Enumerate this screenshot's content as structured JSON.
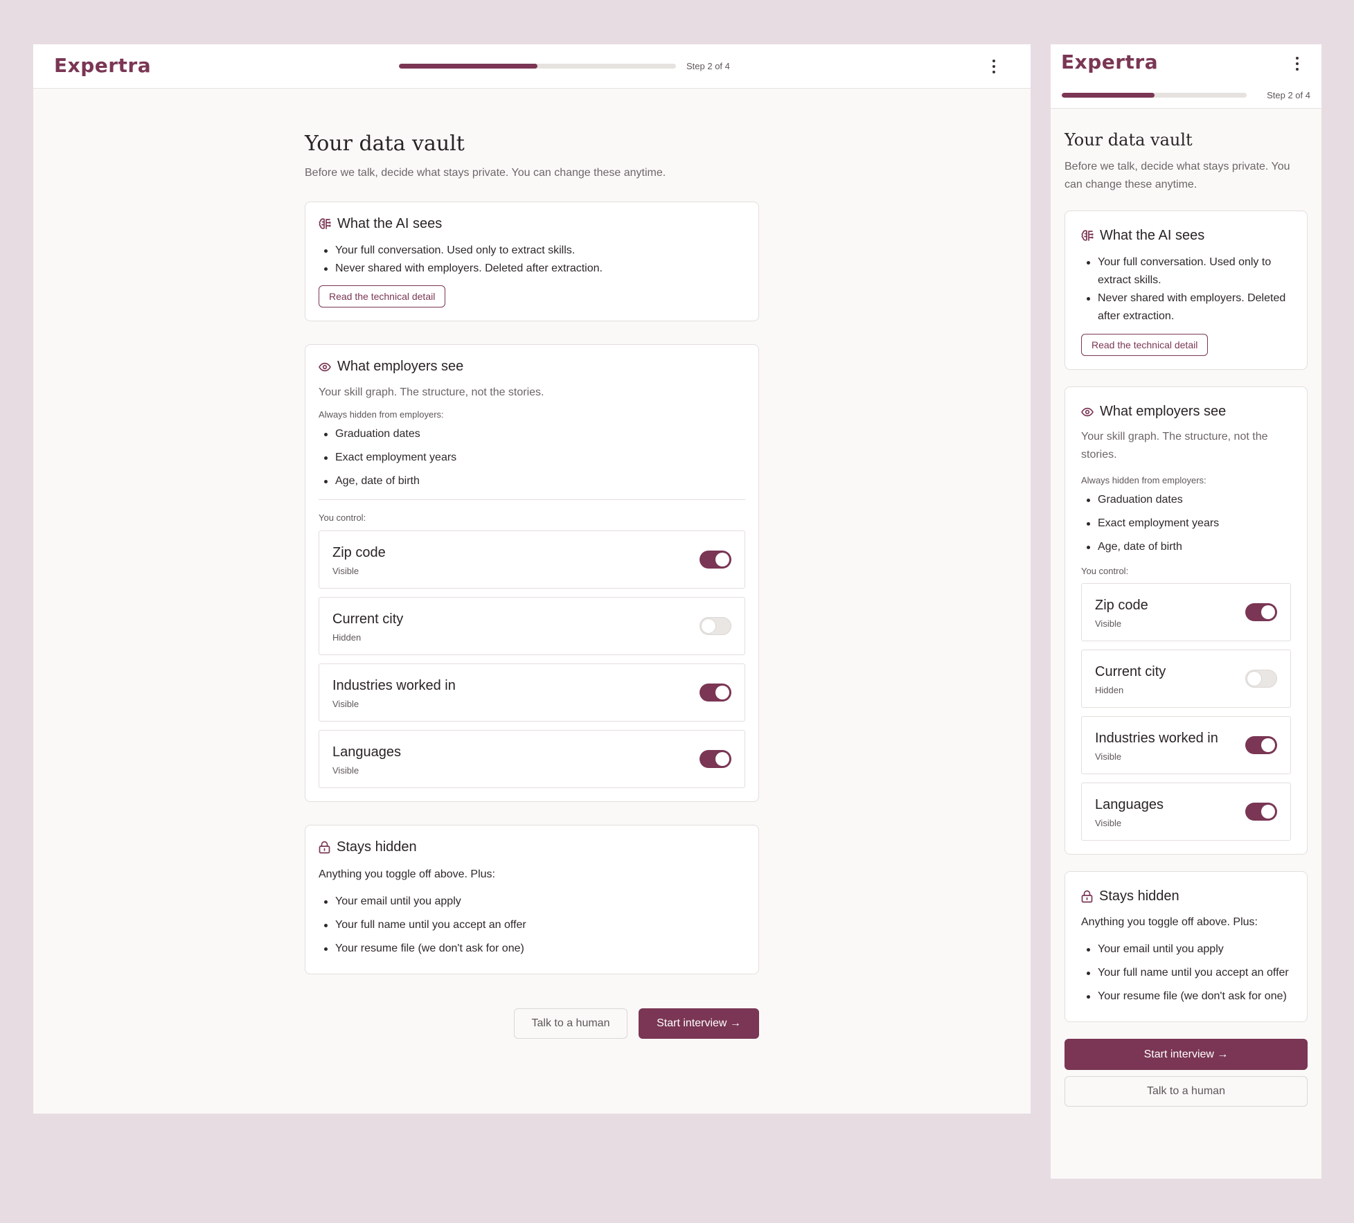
{
  "brand": {
    "name": "Expertra",
    "accent": "#7a3654"
  },
  "progress": {
    "step_label": "Step 2 of 4",
    "fraction": 0.5
  },
  "page": {
    "title": "Your data vault",
    "subtitle": "Before we talk, decide what stays private. You can change these anytime."
  },
  "ai_card": {
    "icon": "brain-icon",
    "title": "What the AI sees",
    "bullets": [
      "Your full conversation. Used only to extract skills.",
      "Never shared with employers. Deleted after extraction."
    ],
    "button_label": "Read the technical detail"
  },
  "employers_card": {
    "icon": "eye-icon",
    "title": "What employers see",
    "description": "Your skill graph. The structure, not the stories.",
    "hidden_label": "Always hidden from employers:",
    "hidden_items": [
      "Graduation dates",
      "Exact employment years",
      "Age, date of birth"
    ],
    "control_label": "You control:",
    "toggles": [
      {
        "name": "Zip code",
        "state": "Visible",
        "on": true
      },
      {
        "name": "Current city",
        "state": "Hidden",
        "on": false
      },
      {
        "name": "Industries worked in",
        "state": "Visible",
        "on": true
      },
      {
        "name": "Languages",
        "state": "Visible",
        "on": true
      }
    ]
  },
  "hidden_card": {
    "icon": "lock-icon",
    "title": "Stays hidden",
    "intro": "Anything you toggle off above. Plus:",
    "items": [
      "Your email until you apply",
      "Your full name until you accept an offer",
      "Your resume file (we don't ask for one)"
    ]
  },
  "actions": {
    "secondary_label": "Talk to a human",
    "primary_label": "Start interview →"
  }
}
